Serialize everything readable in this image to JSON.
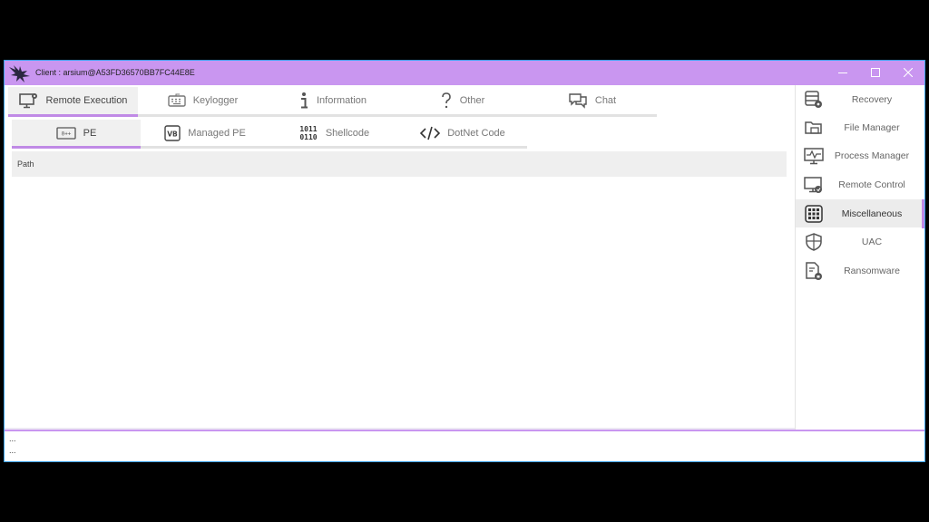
{
  "window": {
    "title": "Client : arsium@A53FD36570BB7FC44E8E",
    "accent": "#c996f0",
    "border_color": "#3aa0e8"
  },
  "tabs_primary": [
    {
      "label": "Remote Execution",
      "icon": "monitor-gear-icon",
      "active": true
    },
    {
      "label": "Keylogger",
      "icon": "keyboard-icon",
      "active": false
    },
    {
      "label": "Information",
      "icon": "info-icon",
      "active": false
    },
    {
      "label": "Other",
      "icon": "question-icon",
      "active": false
    },
    {
      "label": "Chat",
      "icon": "chat-icon",
      "active": false
    }
  ],
  "tabs_secondary": [
    {
      "label": "PE",
      "icon": "binary-chip-icon",
      "active": true
    },
    {
      "label": "Managed PE",
      "icon": "vb-icon",
      "active": false
    },
    {
      "label": "Shellcode",
      "icon": "binary-digits-icon",
      "active": false
    },
    {
      "label": "DotNet Code",
      "icon": "code-brackets-icon",
      "active": false
    }
  ],
  "icon_text": {
    "binary_top": "1011",
    "binary_bottom": "0110",
    "vb": "VB",
    "pe_chip": "0++"
  },
  "path_label": "Path",
  "sidebar": [
    {
      "label": "Recovery",
      "icon": "database-gear-icon",
      "active": false
    },
    {
      "label": "File Manager",
      "icon": "folder-icon",
      "active": false
    },
    {
      "label": "Process Manager",
      "icon": "activity-monitor-icon",
      "active": false
    },
    {
      "label": "Remote Control",
      "icon": "remote-desktop-icon",
      "active": false
    },
    {
      "label": "Miscellaneous",
      "icon": "grid-icon",
      "active": true
    },
    {
      "label": "UAC",
      "icon": "shield-icon",
      "active": false
    },
    {
      "label": "Ransomware",
      "icon": "locked-file-icon",
      "active": false
    }
  ],
  "log_lines": [
    "...",
    "..."
  ]
}
